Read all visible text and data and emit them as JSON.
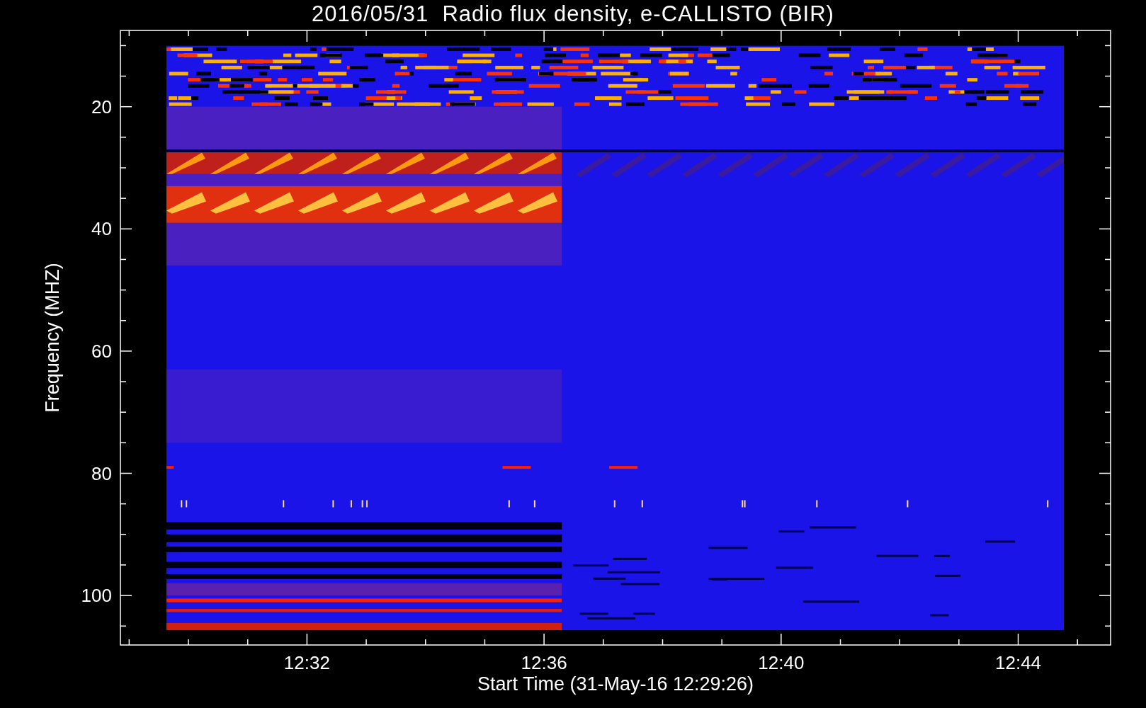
{
  "plot": {
    "title": "2016/05/31  Radio flux density, e-CALLISTO (BIR)",
    "xlabel": "Start Time (31-May-16 12:29:26)",
    "ylabel": "Frequency (MHZ)",
    "yticks": [
      "20",
      "40",
      "60",
      "80",
      "100"
    ],
    "xticks": [
      "12:32",
      "12:36",
      "12:40",
      "12:44"
    ]
  }
}
